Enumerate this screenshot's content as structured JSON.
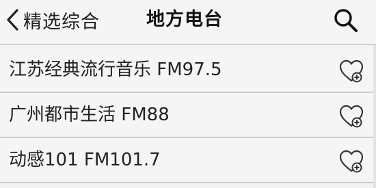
{
  "header": {
    "back_label": "精选综合",
    "title": "地方电台",
    "back_icon": "chevron-left-icon",
    "search_icon": "search-icon"
  },
  "stations": [
    {
      "name": "江苏经典流行音乐 FM97.5",
      "action_icon": "heart-add-icon"
    },
    {
      "name": "广州都市生活 FM88",
      "action_icon": "heart-add-icon"
    },
    {
      "name": "动感101 FM101.7",
      "action_icon": "heart-add-icon"
    }
  ],
  "colors": {
    "background": "#f2f2f2",
    "divider": "#cccccc",
    "text": "#222222"
  }
}
